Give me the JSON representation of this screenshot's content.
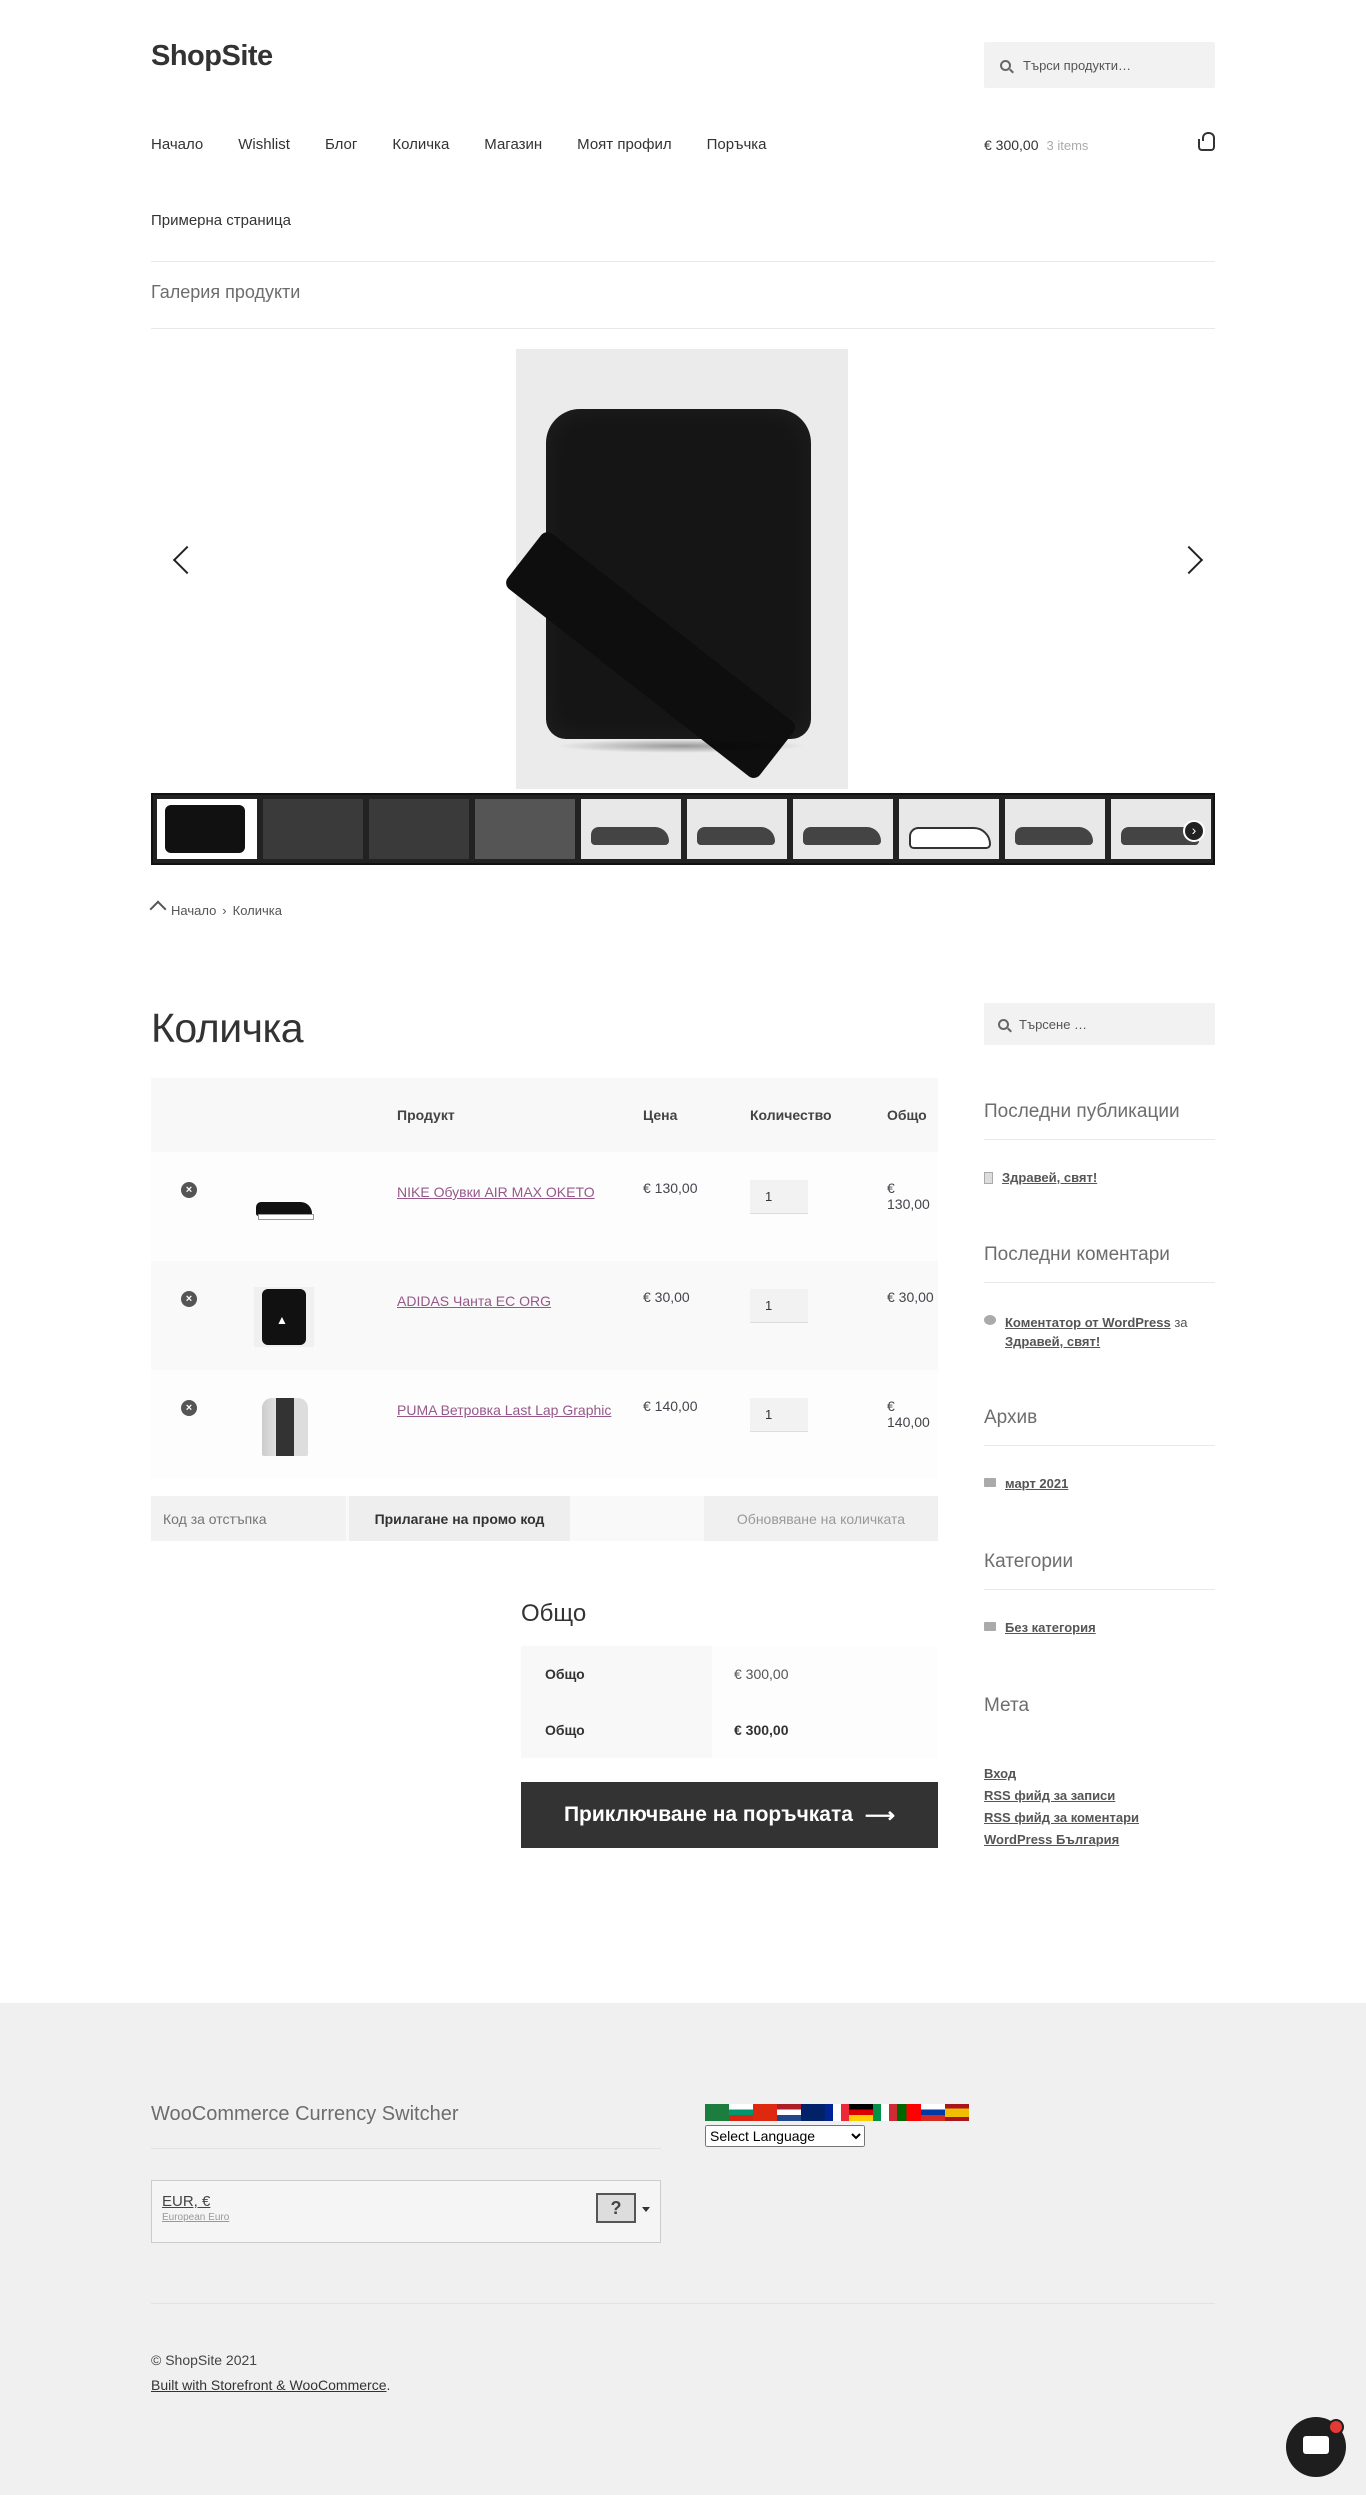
{
  "header": {
    "site_title": "ShopSite",
    "search_placeholder": "Търси продукти…",
    "nav": [
      "Начало",
      "Wishlist",
      "Блог",
      "Количка",
      "Магазин",
      "Моят профил",
      "Поръчка"
    ],
    "nav_second_row": "Примерна страница",
    "cart_amount": "€ 300,00",
    "cart_count": "3 items"
  },
  "gallery": {
    "title": "Галерия продукти",
    "thumbnail_count": 10
  },
  "breadcrumb": {
    "home": "Начало",
    "current": "Количка"
  },
  "cart": {
    "title": "Количка",
    "columns": [
      "Продукт",
      "Цена",
      "Количество",
      "Общо"
    ],
    "items": [
      {
        "name": "NIKE Обувки AIR MAX OKETO",
        "price": "€ 130,00",
        "qty": "1",
        "total": "€ 130,00"
      },
      {
        "name": "ADIDAS Чанта EC ORG",
        "price": "€ 30,00",
        "qty": "1",
        "total": "€ 30,00"
      },
      {
        "name": "PUMA Ветровка Last Lap Graphic",
        "price": "€ 140,00",
        "qty": "1",
        "total": "€ 140,00"
      }
    ],
    "coupon_placeholder": "Код за отстъпка",
    "apply_coupon": "Прилагане на промо код",
    "update_cart": "Обновяване на количката"
  },
  "totals": {
    "title": "Общо",
    "subtotal_label": "Общо",
    "subtotal_value": "€ 300,00",
    "total_label": "Общо",
    "total_value": "€ 300,00",
    "checkout_label": "Приключване на поръчката"
  },
  "sidebar": {
    "search_placeholder": "Търсене …",
    "recent_posts_title": "Последни публикации",
    "recent_post": "Здравей, свят!",
    "recent_comments_title": "Последни коментари",
    "comment_author": "Коментатор от WordPress",
    "comment_on": "за",
    "comment_post": "Здравей, свят!",
    "archive_title": "Архив",
    "archive_item": "март 2021",
    "categories_title": "Категории",
    "category_item": "Без категория",
    "meta_title": "Мета",
    "meta_links": [
      "Вход",
      "RSS фийд за записи",
      "RSS фийд за коментари",
      "WordPress България"
    ]
  },
  "footer": {
    "currency_title": "WooCommerce Currency Switcher",
    "currency_code": "EUR, €",
    "currency_name": "European Euro",
    "language_select": "Select Language",
    "copyright": "© ShopSite 2021",
    "built_link": "Built with Storefront & WooCommerce",
    "built_suffix": "."
  }
}
